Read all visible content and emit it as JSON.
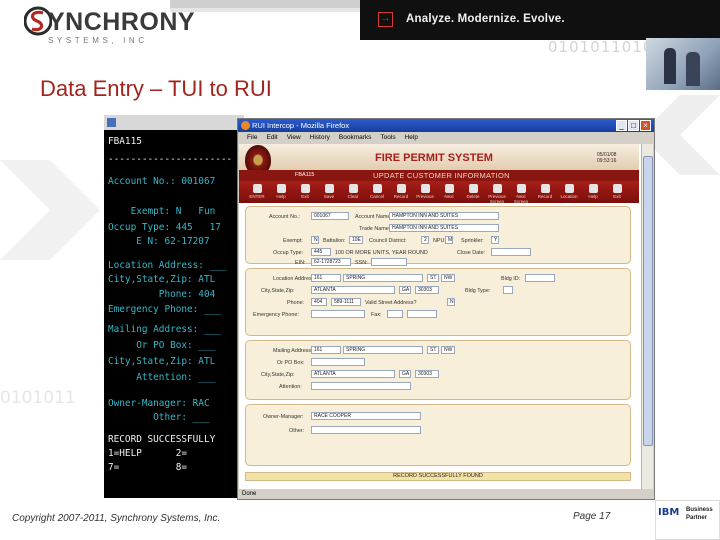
{
  "header": {
    "logo_text": "YNCHRONY",
    "logo_sub": "SYSTEMS, INC",
    "tagline": "Analyze. Modernize. Evolve.",
    "binary_text": "01010110101"
  },
  "slide": {
    "title": "Data Entry – TUI to RUI",
    "background_binary": "0101011"
  },
  "terminal": {
    "lines": [
      "FBA115",
      "----------------------",
      "Account No.: 001067",
      "",
      "    Exempt: N   Fun",
      "Occup Type: 445   17",
      "     E N: 62-17207",
      "",
      "Location Address: ___",
      "City,State,Zip: ATL",
      "         Phone: 404",
      "Emergency Phone: ___",
      "",
      "Mailing Address: ___",
      "     Or PO Box: ___",
      "City,State,Zip: ATL",
      "     Attention: ___",
      "",
      "Owner-Manager: RAC",
      "        Other: ___",
      "RECORD SUCCESSFULLY",
      "1=HELP      2=",
      "7=          8="
    ]
  },
  "browser": {
    "title": "RUI Intercop - Mozilla Firefox",
    "menu": [
      "File",
      "Edit",
      "View",
      "History",
      "Bookmarks",
      "Tools",
      "Help"
    ],
    "status": "Done"
  },
  "app": {
    "title": "FIRE PERMIT SYSTEM",
    "date": "05/01/08\n09:53:16",
    "program": "FBA115",
    "subtitle": "UPDATE CUSTOMER INFORMATION",
    "toolbar": [
      "ENTER",
      "Help",
      "Exit",
      "Save",
      "Clear",
      "Cancel",
      "Record",
      "Previous",
      "Next",
      "Delete",
      "Previous Screen",
      "Next Screen",
      "Record",
      "Location",
      "Help",
      "Exit"
    ],
    "fields": {
      "account_no_label": "Account No.:",
      "account_no": "001067",
      "account_name_label": "Account Name:",
      "account_name": "HAMPTON INN AND SUITES",
      "trade_name_label": "Trade Name:",
      "trade_name": "HAMPTON INN AND SUITES",
      "exempt_label": "Exempt:",
      "exempt": "N",
      "battalion_label": "Battalion:",
      "battalion": "10E",
      "council_label": "Council District:",
      "council": "2",
      "npu_label": "NPU:",
      "npu": "M",
      "sprinkler_label": "Sprinkler:",
      "sprinkler": "Y",
      "occup_label": "Occup Type:",
      "occup": "445",
      "occup_desc": "100 OR MORE UNITS, YEAR ROUND",
      "close_date_label": "Close Date:",
      "ein_label": "EIN:",
      "ein": "62-1728723",
      "ssn_label": "SSN:",
      "loc_address_label": "Location Address:",
      "loc_number": "161",
      "loc_street": "SPRING",
      "loc_st": "ST",
      "loc_dir": "NW",
      "bldg_label": "Bldg ID:",
      "loc_city_label": "City,State,Zip:",
      "loc_city": "ATLANTA",
      "loc_state": "GA",
      "loc_zip": "30303",
      "bldg_type_label": "Bldg Type:",
      "phone_label": "Phone:",
      "phone_area": "404",
      "phone_num": "589-1111",
      "valid_street_label": "Valid Street Address?",
      "valid_street": "N",
      "emergency_label": "Emergency Phone:",
      "fax_label": "Fax:",
      "mail_address_label": "Mailing Address:",
      "mail_number": "161",
      "mail_street": "SPRING",
      "mail_st": "ST",
      "mail_dir": "NW",
      "pobox_label": "Or PO Box:",
      "mail_city_label": "City,State,Zip:",
      "mail_city": "ATLANTA",
      "mail_state": "GA",
      "mail_zip": "30303",
      "attention_label": "Attention:",
      "owner_label": "Owner-Manager:",
      "owner": "RACE COOPER",
      "other_label": "Other:"
    },
    "message": "RECORD SUCCESSFULLY FOUND"
  },
  "footer": {
    "copyright": "Copyright 2007-2011, Synchrony Systems, Inc.",
    "page": "Page 17",
    "partner_brand": "IBM",
    "partner_line1": "Business",
    "partner_line2": "Partner"
  },
  "colors": {
    "title_red": "#a3241e",
    "app_red": "#8a1612",
    "terminal_cyan": "#34b8c8"
  }
}
